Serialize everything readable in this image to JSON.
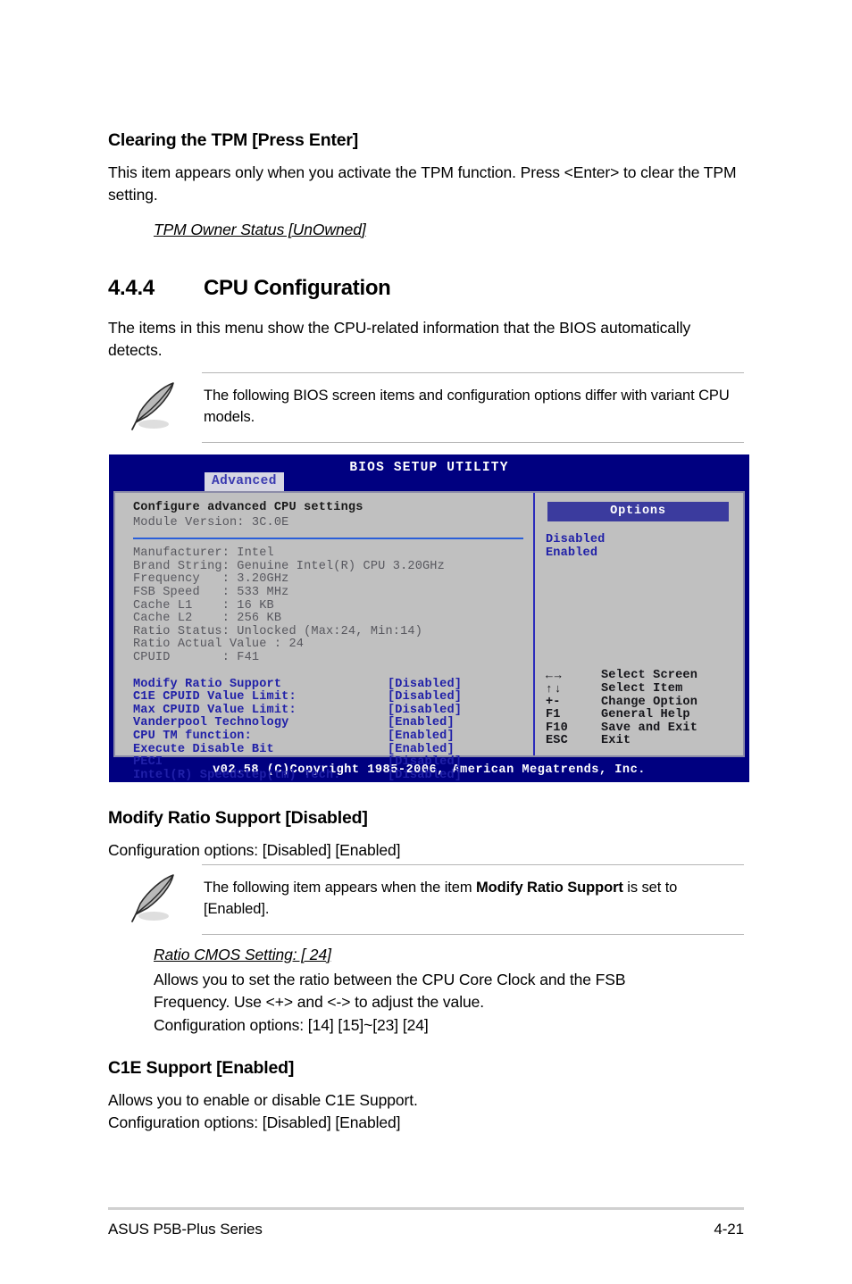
{
  "doc": {
    "tpm_heading": "Clearing the TPM [Press Enter]",
    "tpm_para": "This item appears only when you activate the TPM function. Press <Enter> to clear the TPM setting.",
    "tpm_sub": "TPM Owner Status [UnOwned]",
    "section_number": "4.4.4",
    "section_title": "CPU Configuration",
    "section_para": "The items in this menu show the CPU-related information that the BIOS automatically detects.",
    "note1": "The following BIOS screen items and configuration options differ with variant CPU models.",
    "modify_heading": "Modify Ratio Support [Disabled]",
    "modify_options": "Configuration options: [Disabled] [Enabled]",
    "note2_pre": "The following item appears when the item ",
    "note2_bold": "Modify Ratio Support",
    "note2_post": " is set to [Enabled].",
    "ratio_sub": "Ratio CMOS Setting: [ 24]",
    "ratio_para": "Allows you to set the ratio between the CPU Core Clock and the FSB Frequency. Use <+> and <-> to adjust the value.",
    "ratio_options": "Configuration options: [14] [15]~[23] [24]",
    "c1e_heading": "C1E Support [Enabled]",
    "c1e_para": "Allows you to enable or disable C1E Support.",
    "c1e_options": "Configuration options:  [Disabled] [Enabled]"
  },
  "footer": {
    "left": "ASUS P5B-Plus Series",
    "right": "4-21"
  },
  "bios": {
    "title": "BIOS SETUP UTILITY",
    "tab": "Advanced",
    "left_heading": "Configure advanced CPU settings",
    "module_version": "Module Version: 3C.0E",
    "info": [
      "Manufacturer: Intel",
      "Brand String: Genuine Intel(R) CPU 3.20GHz",
      "Frequency   : 3.20GHz",
      "FSB Speed   : 533 MHz",
      "Cache L1    : 16 KB",
      "Cache L2    : 256 KB",
      "Ratio Status: Unlocked (Max:24, Min:14)",
      "Ratio Actual Value : 24",
      "CPUID       : F41"
    ],
    "settings": [
      {
        "label": "Modify Ratio Support",
        "value": "[Disabled]"
      },
      {
        "label": "C1E CPUID Value Limit:",
        "value": "[Disabled]"
      },
      {
        "label": "Max CPUID Value Limit:",
        "value": "[Disabled]"
      },
      {
        "label": "Vanderpool Technology",
        "value": "[Enabled]"
      },
      {
        "label": "CPU TM function:",
        "value": "[Enabled]"
      },
      {
        "label": "Execute Disable Bit",
        "value": "[Enabled]"
      },
      {
        "label": "PECI",
        "value": "[Disabled]"
      },
      {
        "label": "Intel(R) SpeedStep(tm) Tech.",
        "value": "[Disabled]"
      }
    ],
    "options_header": "Options",
    "options": [
      "Disabled",
      "Enabled"
    ],
    "keys": [
      {
        "sym": "←→",
        "desc": "Select Screen",
        "arrow": true
      },
      {
        "sym": "↑↓",
        "desc": "Select Item",
        "arrow": true
      },
      {
        "sym": "+-",
        "desc": "Change Option",
        "arrow": false
      },
      {
        "sym": "F1",
        "desc": "General Help",
        "arrow": false
      },
      {
        "sym": "F10",
        "desc": "Save and Exit",
        "arrow": false
      },
      {
        "sym": "ESC",
        "desc": "Exit",
        "arrow": false
      }
    ],
    "copyright": "v02.58 (C)Copyright 1985-2006, American Megatrends, Inc."
  },
  "colors": {
    "bios_bg": "#000080",
    "bios_panel": "#c0c0c0",
    "bios_blue_text": "#2020a8",
    "options_header_bg": "#3b3b9e",
    "rule": "#b5b5b5"
  }
}
